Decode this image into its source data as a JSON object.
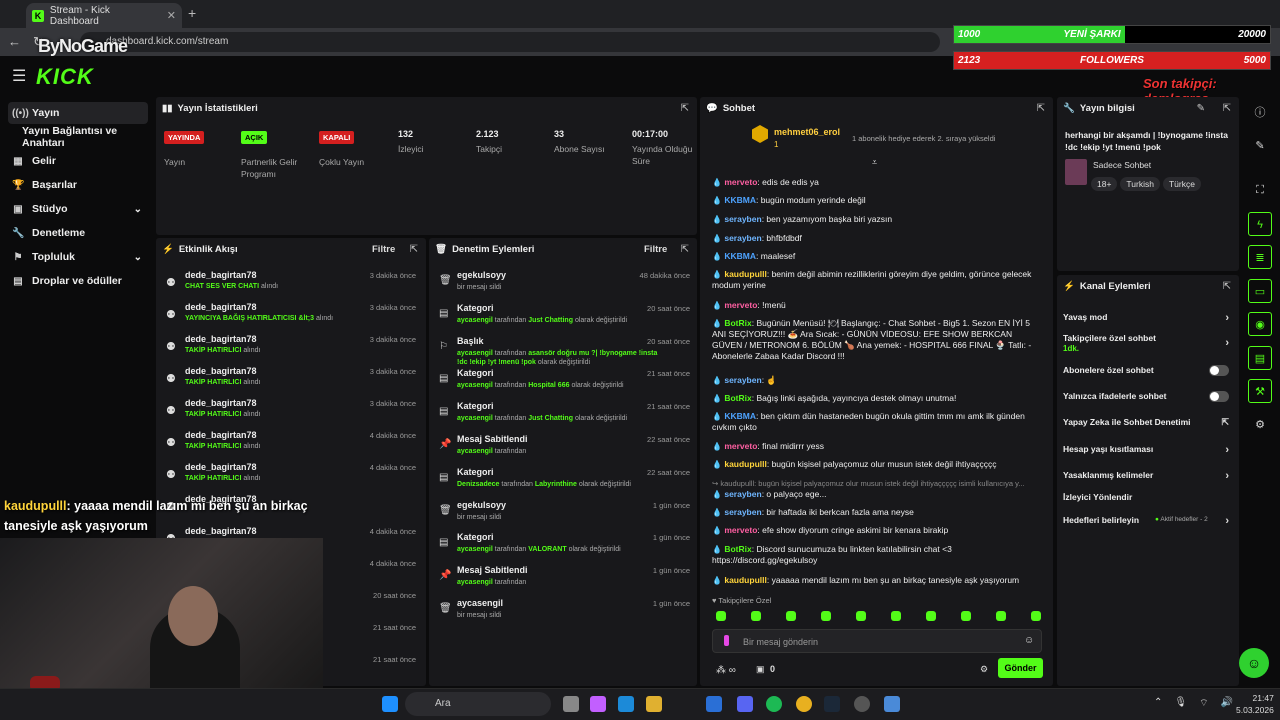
{
  "browser": {
    "tab_title": "Stream - Kick Dashboard",
    "url": "dashboard.kick.com/stream"
  },
  "overlay": {
    "watermark": "ByNoGame",
    "bar1": {
      "left": "1000",
      "label": "YENİ ŞARKI",
      "right": "20000",
      "progress": 0.54
    },
    "bar2": {
      "left": "2123",
      "label": "FOLLOWERS",
      "right": "5000",
      "progress": 1.0
    },
    "last_follower": "Son takipçi: demlogras",
    "chat_message": {
      "user": "kaudupulll",
      "text": ": yaaaa mendil lazım mı ben şu an birkaç tanesiyle aşk yaşıyorum"
    }
  },
  "sidebar": {
    "items": [
      {
        "label": "Yayın",
        "icon": "broadcast-icon"
      },
      {
        "label": "Yayın Bağlantısı ve Anahtarı"
      },
      {
        "label": "Gelir",
        "icon": "grid-icon"
      },
      {
        "label": "Başarılar",
        "icon": "trophy-icon"
      },
      {
        "label": "Stüdyo",
        "icon": "studio-icon"
      },
      {
        "label": "Denetleme",
        "icon": "wrench-icon"
      },
      {
        "label": "Topluluk",
        "icon": "community-icon"
      },
      {
        "label": "Droplar ve ödüller",
        "icon": "drops-icon"
      }
    ]
  },
  "stats": {
    "title": "Yayın İstatistikleri",
    "items": [
      {
        "badge": "YAYINDA",
        "label": "Yayın",
        "color": "#d41f1f"
      },
      {
        "badge": "AÇIK",
        "label": "Partnerlik Gelir Programı",
        "color": "#53fc18"
      },
      {
        "badge": "KAPALI",
        "label": "Çoklu Yayın",
        "color": "#d41f1f"
      },
      {
        "value": "132",
        "label": "İzleyici"
      },
      {
        "value": "2.123",
        "label": "Takipçi"
      },
      {
        "value": "33",
        "label": "Abone Sayısı"
      },
      {
        "value": "00:17:00",
        "label": "Yayında Olduğu Süre"
      }
    ]
  },
  "activity": {
    "title": "Etkinlik Akışı",
    "filter": "Filtre",
    "items": [
      {
        "name": "dede_bagirtan78",
        "event": "CHAT SES VER CHATI",
        "suffix": "alındı",
        "time": "3 dakika önce"
      },
      {
        "name": "dede_bagirtan78",
        "event": "YAYINCIYA BAĞIŞ HATIRLATICISI &lt;3",
        "suffix": "alındı",
        "time": "3 dakika önce"
      },
      {
        "name": "dede_bagirtan78",
        "event": "TAKİP HATIRLICI",
        "suffix": "alındı",
        "time": "3 dakika önce"
      },
      {
        "name": "dede_bagirtan78",
        "event": "TAKİP HATIRLICI",
        "suffix": "alındı",
        "time": "3 dakika önce"
      },
      {
        "name": "dede_bagirtan78",
        "event": "TAKİP HATIRLICI",
        "suffix": "alındı",
        "time": "3 dakika önce"
      },
      {
        "name": "dede_bagirtan78",
        "event": "TAKİP HATIRLICI",
        "suffix": "alındı",
        "time": "4 dakika önce"
      },
      {
        "name": "dede_bagirtan78",
        "event": "TAKİP HATIRLICI",
        "suffix": "alındı",
        "time": "4 dakika önce"
      },
      {
        "name": "dede_bagirtan78",
        "event": "",
        "suffix": "",
        "time": ""
      },
      {
        "name": "dede_bagirtan78",
        "event": "",
        "suffix": "",
        "time": "4 dakika önce"
      },
      {
        "name": "",
        "event": "",
        "suffix": "",
        "time": "4 dakika önce"
      },
      {
        "name": "",
        "event": "",
        "suffix": "",
        "time": "20 saat önce"
      },
      {
        "name": "",
        "event": "",
        "suffix": "",
        "time": "21 saat önce"
      },
      {
        "name": "",
        "event": "",
        "suffix": "",
        "time": "21 saat önce"
      }
    ]
  },
  "moderation": {
    "title": "Denetim Eylemleri",
    "filter": "Filtre",
    "items": [
      {
        "icon": "trash-icon",
        "name": "egekulsoyy",
        "desc": "bir mesajı sildi",
        "time": "48 dakika önce"
      },
      {
        "icon": "category-icon",
        "name": "Kategori",
        "desc_user": "aycasengil",
        "desc_mid": "tarafından",
        "desc_val": "Just Chatting",
        "desc_end": "olarak değiştirildi",
        "time": "20 saat önce"
      },
      {
        "icon": "title-icon",
        "name": "Başlık",
        "desc_user": "aycasengil",
        "desc_mid": "tarafından",
        "desc_val": "asansör doğru mu ?| !bynogame !insta !dc !ekip !yt !menü !pok",
        "desc_end": "olarak değiştirildi",
        "time": "20 saat önce"
      },
      {
        "icon": "category-icon",
        "name": "Kategori",
        "desc_user": "aycasengil",
        "desc_mid": "tarafından",
        "desc_val": "Hospital 666",
        "desc_end": "olarak değiştirildi",
        "time": "21 saat önce"
      },
      {
        "icon": "category-icon",
        "name": "Kategori",
        "desc_user": "aycasengil",
        "desc_mid": "tarafından",
        "desc_val": "Just Chatting",
        "desc_end": "olarak değiştirildi",
        "time": "21 saat önce"
      },
      {
        "icon": "pin-icon",
        "name": "Mesaj Sabitlendi",
        "desc_user": "aycasengil",
        "desc_mid": "tarafından",
        "desc_val": "",
        "desc_end": "",
        "time": "22 saat önce"
      },
      {
        "icon": "category-icon",
        "name": "Kategori",
        "desc_user": "Denizsadece",
        "desc_mid": "tarafından",
        "desc_val": "Labyrinthine",
        "desc_end": "olarak değiştirildi",
        "time": "22 saat önce"
      },
      {
        "icon": "trash-icon",
        "name": "egekulsoyy",
        "desc": "bir mesajı sildi",
        "time": "1 gün önce"
      },
      {
        "icon": "category-icon",
        "name": "Kategori",
        "desc_user": "aycasengil",
        "desc_mid": "tarafından",
        "desc_val": "VALORANT",
        "desc_end": "olarak değiştirildi",
        "time": "1 gün önce"
      },
      {
        "icon": "pin-icon",
        "name": "Mesaj Sabitlendi",
        "desc_user": "aycasengil",
        "desc_mid": "tarafından",
        "desc_val": "",
        "desc_end": "",
        "time": "1 gün önce"
      },
      {
        "icon": "trash-icon",
        "name": "aycasengil",
        "desc": "bir mesajı sildi",
        "time": "1 gün önce"
      }
    ]
  },
  "chat": {
    "title": "Sohbet",
    "pinned": {
      "user": "mehmet06_erol",
      "count": "1",
      "text": "1 abonelik hediye ederek 2. sıraya yükseldi"
    },
    "messages": [
      {
        "user": "merveto",
        "color": "#ff5fa2",
        "text": ": edis de edis ya"
      },
      {
        "user": "KKBMA",
        "color": "#4ea3ff",
        "text": ": bugün modum yerinde değil"
      },
      {
        "user": "serayben",
        "color": "#6fb6ff",
        "text": ": ben yazamıyom başka biri yazsın"
      },
      {
        "user": "serayben",
        "color": "#6fb6ff",
        "text": ": bhfbfdbdf"
      },
      {
        "user": "KKBMA",
        "color": "#4ea3ff",
        "text": ": maalesef"
      },
      {
        "user": "kaudupulll",
        "color": "#ffd43b",
        "text": ": benim değil abimin rezilliklerini göreyim diye geldim, görünce gelecek modum yerine"
      },
      {
        "user": "merveto",
        "color": "#ff5fa2",
        "text": ": !menü"
      },
      {
        "user": "BotRix",
        "color": "#53fc18",
        "text": ": Bugünün Menüsü! 🍽 Başlangıç: - Chat Sohbet - Big5 1. Sezon EN İYİ 5 ANI SEÇİYORUZ!!! 🍝 Ara Sıcak: - GÜNÜN VİDEOSU: EFE SHOW BERKCAN GÜVEN / METRONOM 6. BÖLÜM 🍗 Ana yemek: - HOSPITAL 666 FINAL 🍨 Tatlı: - Abonelerle Zabaa Kadar Discord !!!"
      },
      {
        "user": "serayben",
        "color": "#6fb6ff",
        "text": ": ☝"
      },
      {
        "user": "BotRix",
        "color": "#53fc18",
        "text": ": Bağış linki aşağıda, yayıncıya destek olmayı unutma!"
      },
      {
        "user": "KKBMA",
        "color": "#4ea3ff",
        "text": ": ben çıktım dün hastaneden bugün okula gittim tmm mı amk ilk günden cıvkım çıkto"
      },
      {
        "user": "merveto",
        "color": "#ff5fa2",
        "text": ": final midirrr yess"
      },
      {
        "user": "kaudupulll",
        "color": "#ffd43b",
        "text": ": bugün kişisel palyaçomuz olur musun istek değil ihtiyaççççç"
      },
      {
        "user": "",
        "color": "#999",
        "text": "↪ kaudupulll: bugün kişisel palyaçomuz olur musun istek değil ihtiyaççççç isimli kullanıcıya y..."
      },
      {
        "user": "serayben",
        "color": "#6fb6ff",
        "text": ": o palyaço ege..."
      },
      {
        "user": "serayben",
        "color": "#6fb6ff",
        "text": ": bir haftada iki berkcan fazla ama neyse"
      },
      {
        "user": "merveto",
        "color": "#ff5fa2",
        "text": ": efe show diyorum cringe askimi bir kenara birakip"
      },
      {
        "user": "BotRix",
        "color": "#53fc18",
        "text": ": Discord sunucumuza bu linkten katılabilirsin chat <3 https://discord.gg/egekulsoy"
      },
      {
        "user": "kaudupulll",
        "color": "#ffd43b",
        "text": ": yaaaaa mendil lazım mı ben şu an birkaç tanesiyle aşk yaşıyorum"
      }
    ],
    "mode_label": "Takipçilere Özel",
    "input_placeholder": "Bir mesaj gönderin",
    "points": "0",
    "send": "Gönder"
  },
  "stream_info": {
    "title": "Yayın bilgisi",
    "stream_title": "herhangi bir akşamdı | !bynogame !insta !dc !ekip !yt !menü !pok",
    "category": "Sadece Sohbet",
    "tags": [
      "18+",
      "Turkish",
      "Türkçe"
    ]
  },
  "channel_actions": {
    "title": "Kanal Eylemleri",
    "items": [
      {
        "label": "Yavaş mod",
        "type": "chevron"
      },
      {
        "label": "Takipçilere özel sohbet",
        "sub": "1dk.",
        "type": "chevron"
      },
      {
        "label": "Abonelere özel sohbet",
        "type": "toggle"
      },
      {
        "label": "Yalnızca ifadelerle sohbet",
        "type": "toggle"
      },
      {
        "label": "Yapay Zeka ile Sohbet Denetimi",
        "type": "external"
      },
      {
        "label": "Hesap yaşı kısıtlaması",
        "type": "chevron"
      },
      {
        "label": "Yasaklanmış kelimeler",
        "type": "chevron"
      },
      {
        "label": "İzleyici Yönlendir",
        "type": "none"
      },
      {
        "label": "Hedefleri belirleyin",
        "extra": "Aktif hedefler - 2",
        "type": "chevron"
      }
    ]
  },
  "taskbar": {
    "search": "Ara",
    "time": "21:47",
    "date": "5.03.2026"
  }
}
